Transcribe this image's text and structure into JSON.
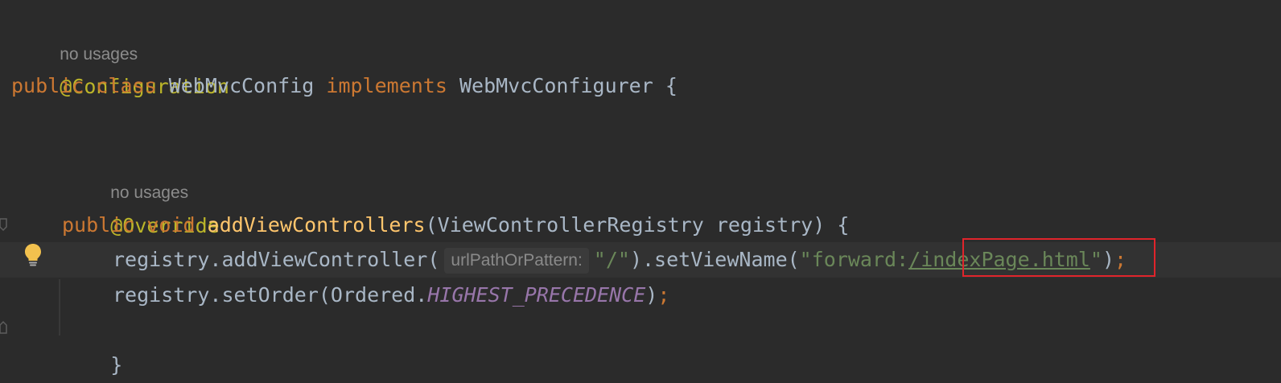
{
  "code": {
    "usage_hint_class": "no usages",
    "annotation_class": "@Configuration",
    "class_line": {
      "kw_public": "public",
      "kw_class": "class",
      "class_name": "WebMvcConfig",
      "kw_implements": "implements",
      "interface_name": "WebMvcConfigurer",
      "brace": "{"
    },
    "usage_hint_method": "no usages",
    "annotation_method": "@Override",
    "method_line": {
      "kw_public": "public",
      "kw_void": "void",
      "method_name": "addViewControllers",
      "params": "(ViewControllerRegistry registry) {"
    },
    "line_add_view": {
      "prefix": "registry.addViewController(",
      "param_hint": "urlPathOrPattern:",
      "arg": "\"/\"",
      "mid": ").setViewName(",
      "str_open": "\"forward:",
      "str_link": "/indexPage.html",
      "str_close": "\"",
      "end_paren": ")",
      "semicolon": ";"
    },
    "line_set_order": {
      "prefix": "registry.setOrder(Ordered.",
      "constant": "HIGHEST_PRECEDENCE",
      "end_paren": ")",
      "semicolon": ";"
    },
    "close_method": "}"
  },
  "colors": {
    "background": "#2b2b2b",
    "keyword": "#cc7832",
    "annotation": "#bbb529",
    "string": "#6a8759",
    "method": "#ffc66d",
    "constant": "#9876aa",
    "highlight_box": "#e0242b",
    "bulb": "#f2c14e"
  },
  "icons": {
    "intention": "lightbulb-icon"
  }
}
